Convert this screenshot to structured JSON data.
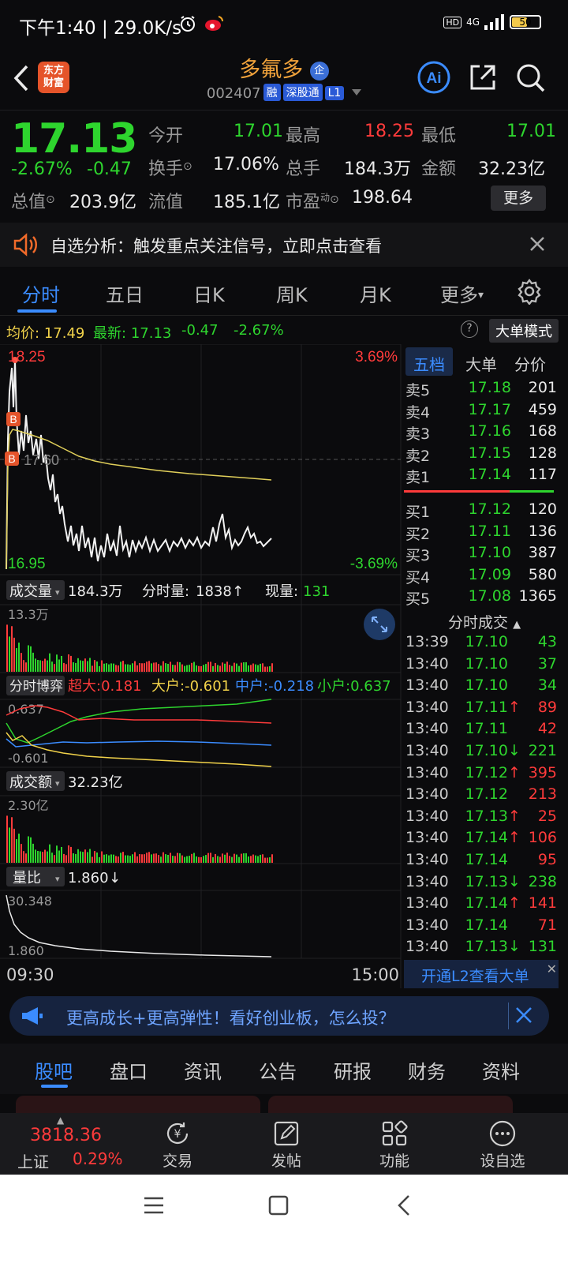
{
  "status": {
    "time": "下午1:40 | 29.0K/s",
    "net": "4G",
    "hd": "HD",
    "battery": "50"
  },
  "header": {
    "logo_line1": "东方",
    "logo_line2": "财富",
    "name": "多氟多",
    "code": "002407",
    "tags": [
      "融",
      "深股通",
      "L1"
    ]
  },
  "quote": {
    "price": "17.13",
    "change_pct": "-2.67%",
    "change": "-0.47",
    "open_label": "今开",
    "open": "17.01",
    "high_label": "最高",
    "high": "18.25",
    "low_label": "最低",
    "low": "17.01",
    "turnover_label": "换手",
    "turnover": "17.06%",
    "volume_label": "总手",
    "volume": "184.3万",
    "amount_label": "金额",
    "amount": "32.23亿",
    "mktcap_label": "总值",
    "mktcap": "203.9亿",
    "float_label": "流值",
    "float": "185.1亿",
    "pe_label": "市盈",
    "pe_sup": "动",
    "pe": "198.64",
    "more": "更多"
  },
  "alert": {
    "text": "自选分析：触发重点关注信号，立即点击查看"
  },
  "tabs": [
    "分时",
    "五日",
    "日K",
    "周K",
    "月K",
    "更多"
  ],
  "chart": {
    "avg_label": "均价:",
    "avg": "17.49",
    "latest_label": "最新:",
    "latest": "17.13",
    "chg": "-0.47",
    "pct": "-2.67%",
    "help": "?",
    "bigmode": "大单模式",
    "ymax": "18.25",
    "ymin": "16.95",
    "pmax": "3.69%",
    "pmin": "-3.69%",
    "mid": "17.60",
    "b_marker": "B",
    "vol_label": "成交量",
    "vol_total": "184.3万",
    "vol_min_label": "分时量:",
    "vol_min": "1838",
    "vol_now_label": "现量:",
    "vol_now": "131",
    "vol_max": "13.3万",
    "game_label": "分时博弈",
    "super_label": "超大:",
    "super": "0.181",
    "big_label": "大户:",
    "big": "-0.601",
    "mid_label": "中户:",
    "midv": "-0.218",
    "small_label": "小户:",
    "small": "0.637",
    "game_top": "0.637",
    "game_bot": "-0.601",
    "amt_label": "成交额",
    "amt_total": "32.23亿",
    "amt_max": "2.30亿",
    "ratio_label": "量比",
    "ratio": "1.860",
    "ratio_top": "30.348",
    "ratio_bot": "1.860",
    "t_start": "09:30",
    "t_end": "15:00"
  },
  "book": {
    "tabs": [
      "五档",
      "大单",
      "分价"
    ],
    "asks": [
      {
        "label": "卖5",
        "price": "17.18",
        "vol": "201"
      },
      {
        "label": "卖4",
        "price": "17.17",
        "vol": "459"
      },
      {
        "label": "卖3",
        "price": "17.16",
        "vol": "168"
      },
      {
        "label": "卖2",
        "price": "17.15",
        "vol": "128"
      },
      {
        "label": "卖1",
        "price": "17.14",
        "vol": "117"
      }
    ],
    "bids": [
      {
        "label": "买1",
        "price": "17.12",
        "vol": "120"
      },
      {
        "label": "买2",
        "price": "17.11",
        "vol": "136"
      },
      {
        "label": "买3",
        "price": "17.10",
        "vol": "387"
      },
      {
        "label": "买4",
        "price": "17.09",
        "vol": "580"
      },
      {
        "label": "买5",
        "price": "17.08",
        "vol": "1365"
      }
    ],
    "trades_title": "分时成交",
    "trades": [
      {
        "t": "13:39",
        "p": "17.10",
        "arrow": "",
        "v": "43",
        "vc": "green",
        "pc": "green"
      },
      {
        "t": "13:40",
        "p": "17.10",
        "arrow": "",
        "v": "37",
        "vc": "green",
        "pc": "green"
      },
      {
        "t": "13:40",
        "p": "17.10",
        "arrow": "",
        "v": "34",
        "vc": "green",
        "pc": "green"
      },
      {
        "t": "13:40",
        "p": "17.11",
        "arrow": "↑",
        "v": "89",
        "vc": "red",
        "pc": "green"
      },
      {
        "t": "13:40",
        "p": "17.11",
        "arrow": "",
        "v": "42",
        "vc": "red",
        "pc": "green"
      },
      {
        "t": "13:40",
        "p": "17.10",
        "arrow": "↓",
        "v": "221",
        "vc": "green",
        "pc": "green"
      },
      {
        "t": "13:40",
        "p": "17.12",
        "arrow": "↑",
        "v": "395",
        "vc": "red",
        "pc": "green"
      },
      {
        "t": "13:40",
        "p": "17.12",
        "arrow": "",
        "v": "213",
        "vc": "red",
        "pc": "green"
      },
      {
        "t": "13:40",
        "p": "17.13",
        "arrow": "↑",
        "v": "25",
        "vc": "red",
        "pc": "green"
      },
      {
        "t": "13:40",
        "p": "17.14",
        "arrow": "↑",
        "v": "106",
        "vc": "red",
        "pc": "green"
      },
      {
        "t": "13:40",
        "p": "17.14",
        "arrow": "",
        "v": "95",
        "vc": "red",
        "pc": "green"
      },
      {
        "t": "13:40",
        "p": "17.13",
        "arrow": "↓",
        "v": "238",
        "vc": "green",
        "pc": "green"
      },
      {
        "t": "13:40",
        "p": "17.14",
        "arrow": "↑",
        "v": "141",
        "vc": "red",
        "pc": "green"
      },
      {
        "t": "13:40",
        "p": "17.14",
        "arrow": "",
        "v": "71",
        "vc": "red",
        "pc": "green"
      },
      {
        "t": "13:40",
        "p": "17.13",
        "arrow": "↓",
        "v": "131",
        "vc": "green",
        "pc": "green"
      }
    ],
    "l2": "开通L2查看大单"
  },
  "ad": {
    "text": "更高成长+更高弹性！看好创业板，怎么投？"
  },
  "bottom_tabs": [
    "股吧",
    "盘口",
    "资讯",
    "公告",
    "研报",
    "财务",
    "资料"
  ],
  "toolbar": {
    "index_value": "3818.36",
    "index_name": "上证",
    "index_pct": "0.29%",
    "items": [
      "交易",
      "发帖",
      "功能",
      "设自选"
    ]
  },
  "colors": {
    "up": "#ff3b3b",
    "down": "#2ed52e",
    "accent": "#3b8cff",
    "name": "#f0a23b"
  }
}
